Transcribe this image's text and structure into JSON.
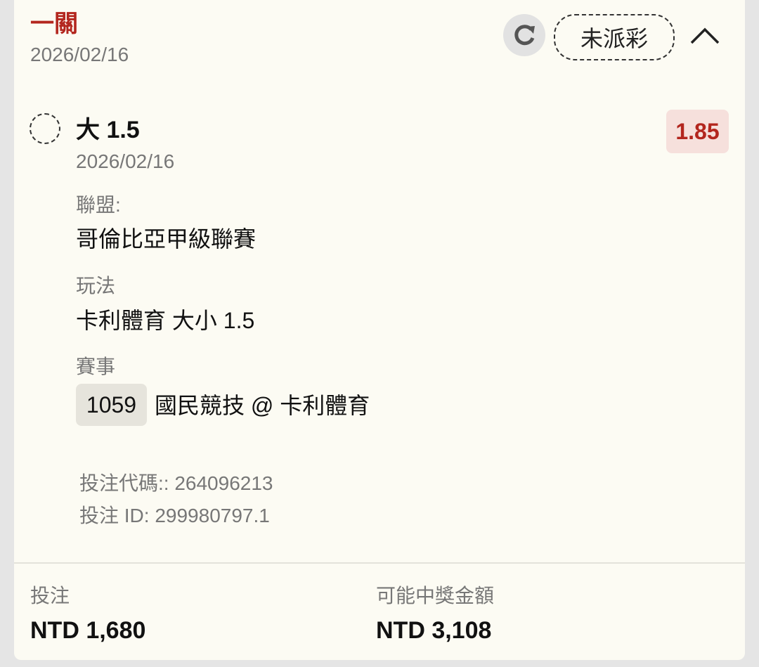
{
  "header": {
    "bet_type": "一關",
    "date": "2026/02/16",
    "status": "未派彩",
    "icons": {
      "refresh": "refresh-icon",
      "collapse": "chevron-up-icon"
    }
  },
  "selection": {
    "name": "大 1.5",
    "date": "2026/02/16",
    "odds": "1.85",
    "league_label": "聯盟:",
    "league": "哥倫比亞甲級聯賽",
    "market_label": "玩法",
    "market": "卡利體育 大小 1.5",
    "event_label": "賽事",
    "match_number": "1059",
    "match_name": "國民競技 @ 卡利體育"
  },
  "meta": {
    "bet_code": "投注代碼:: 264096213",
    "bet_id": "投注 ID: 299980797.1"
  },
  "footer": {
    "stake_label": "投注",
    "stake_value": "NTD 1,680",
    "payout_label": "可能中獎金額",
    "payout_value": "NTD 3,108"
  },
  "colors": {
    "accent_red": "#b3261e",
    "card_bg": "#fcfbf3",
    "odds_bg": "#f6e0dc"
  }
}
